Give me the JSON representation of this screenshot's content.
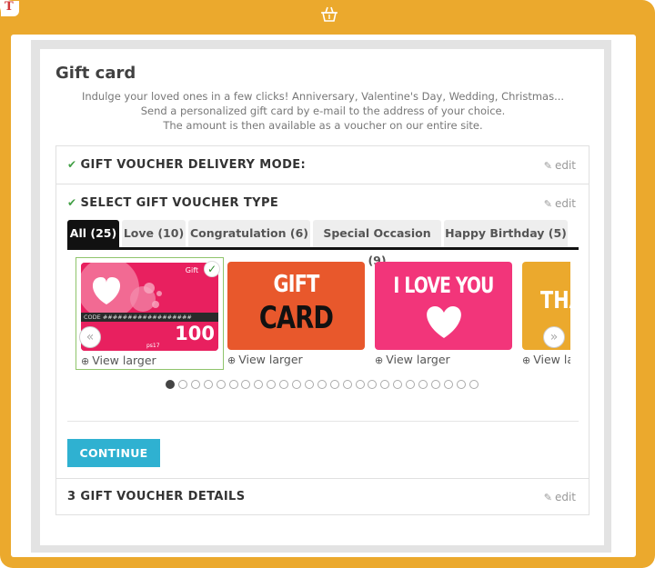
{
  "page": {
    "title": "Gift card",
    "intro": [
      "Indulge your loved ones in a few clicks! Anniversary, Valentine's Day, Wedding, Christmas...",
      "Send a personalized gift card by e-mail to the address of your choice.",
      "The amount is then available as a voucher on our entire site."
    ]
  },
  "steps": {
    "delivery": {
      "check": "✔",
      "title": "GIFT VOUCHER DELIVERY MODE:",
      "edit": "edit"
    },
    "type": {
      "check": "✔",
      "title": "SELECT GIFT VOUCHER TYPE",
      "edit": "edit"
    },
    "details": {
      "title": "3 GIFT VOUCHER DETAILS",
      "edit": "edit"
    }
  },
  "tabs": [
    {
      "label": "All (25)",
      "active": true
    },
    {
      "label": "Love (10)",
      "active": false
    },
    {
      "label": "Congratulation (6)",
      "active": false
    },
    {
      "label": "Special Occasion (9)",
      "active": false
    },
    {
      "label": "Happy Birthday (5)",
      "active": false
    }
  ],
  "cards": [
    {
      "zoom_label": "View larger",
      "card_text_gift": "Gift",
      "card_code": "CODE ##################",
      "card_amount": "100",
      "card_footer": "ps17",
      "selected": true
    },
    {
      "zoom_label": "View larger",
      "line1": "GIFT",
      "line2": "CARD"
    },
    {
      "zoom_label": "View larger",
      "line1": "I LOVE YOU"
    },
    {
      "zoom_label": "View la",
      "line1": "THA"
    }
  ],
  "carousel": {
    "prev_icon": "«",
    "next_icon": "»",
    "dot_count": 25,
    "active_dot": 0
  },
  "continue_label": "CONTINUE",
  "colors": {
    "frame": "#eba92d",
    "accent": "#2fb1d1",
    "card1": "#e8205f",
    "card2": "#e8582c",
    "card3": "#f2357a",
    "card4": "#eba92d"
  },
  "icons": {
    "pencil": "pencil-icon",
    "zoom": "zoom-in-icon",
    "check": "check-icon"
  }
}
